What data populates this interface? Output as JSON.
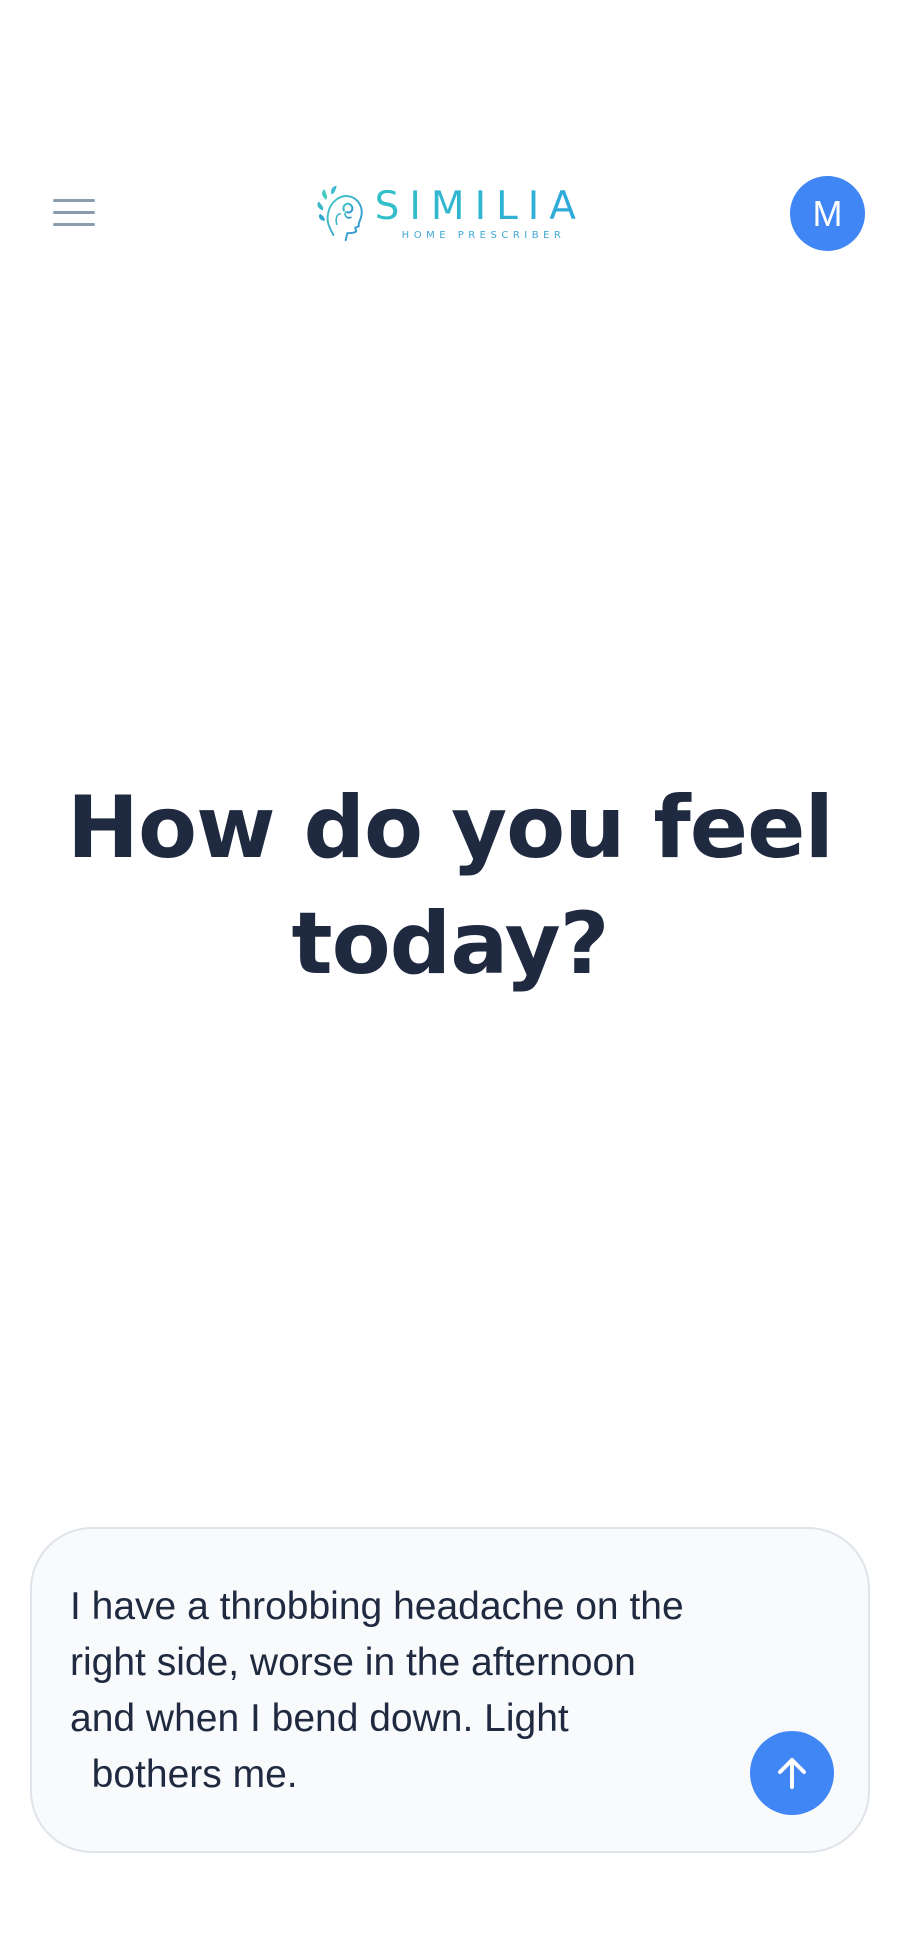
{
  "header": {
    "menu_icon": "hamburger-menu-icon",
    "logo": {
      "name": "SIMILIA",
      "tagline": "HOME PRESCRIBER",
      "icon": "head-leaf-logo-icon"
    },
    "avatar_initial": "M"
  },
  "main": {
    "heading": "How do you feel today?"
  },
  "composer": {
    "value": "I have a throbbing headache on the\nright side, worse in the afternoon\nand when I bend down. Light\n  bothers me.",
    "send_icon": "arrow-up-icon"
  },
  "colors": {
    "accent": "#4086f4",
    "logo_teal": "#2fb4c8",
    "heading": "#1f2a40",
    "menu_icon": "#8a9bb0"
  }
}
